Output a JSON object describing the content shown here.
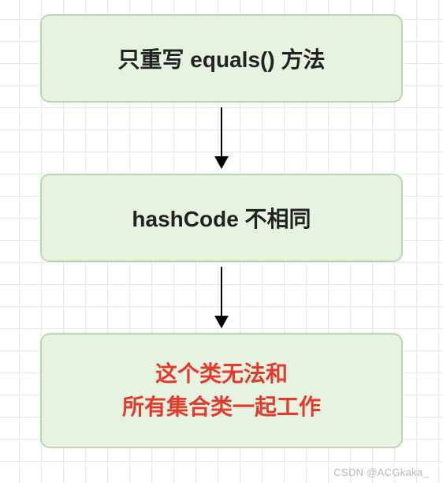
{
  "chart_data": {
    "type": "flowchart",
    "direction": "top-to-bottom",
    "nodes": [
      {
        "id": "n1",
        "text": "只重写 equals() 方法",
        "color": "#222222",
        "bg": "#e5f3e0"
      },
      {
        "id": "n2",
        "text": "hashCode 不相同",
        "color": "#222222",
        "bg": "#e5f3e0"
      },
      {
        "id": "n3",
        "text_lines": [
          "这个类无法和",
          "所有集合类一起工作"
        ],
        "color": "#e33a2e",
        "bg": "#e5f3e0"
      }
    ],
    "edges": [
      {
        "from": "n1",
        "to": "n2",
        "style": "arrow"
      },
      {
        "from": "n2",
        "to": "n3",
        "style": "arrow"
      }
    ]
  },
  "node1_text": "只重写 equals() 方法",
  "node2_text": "hashCode 不相同",
  "node3_line1": "这个类无法和",
  "node3_line2": "所有集合类一起工作",
  "watermark": "CSDN @ACGkaka_"
}
